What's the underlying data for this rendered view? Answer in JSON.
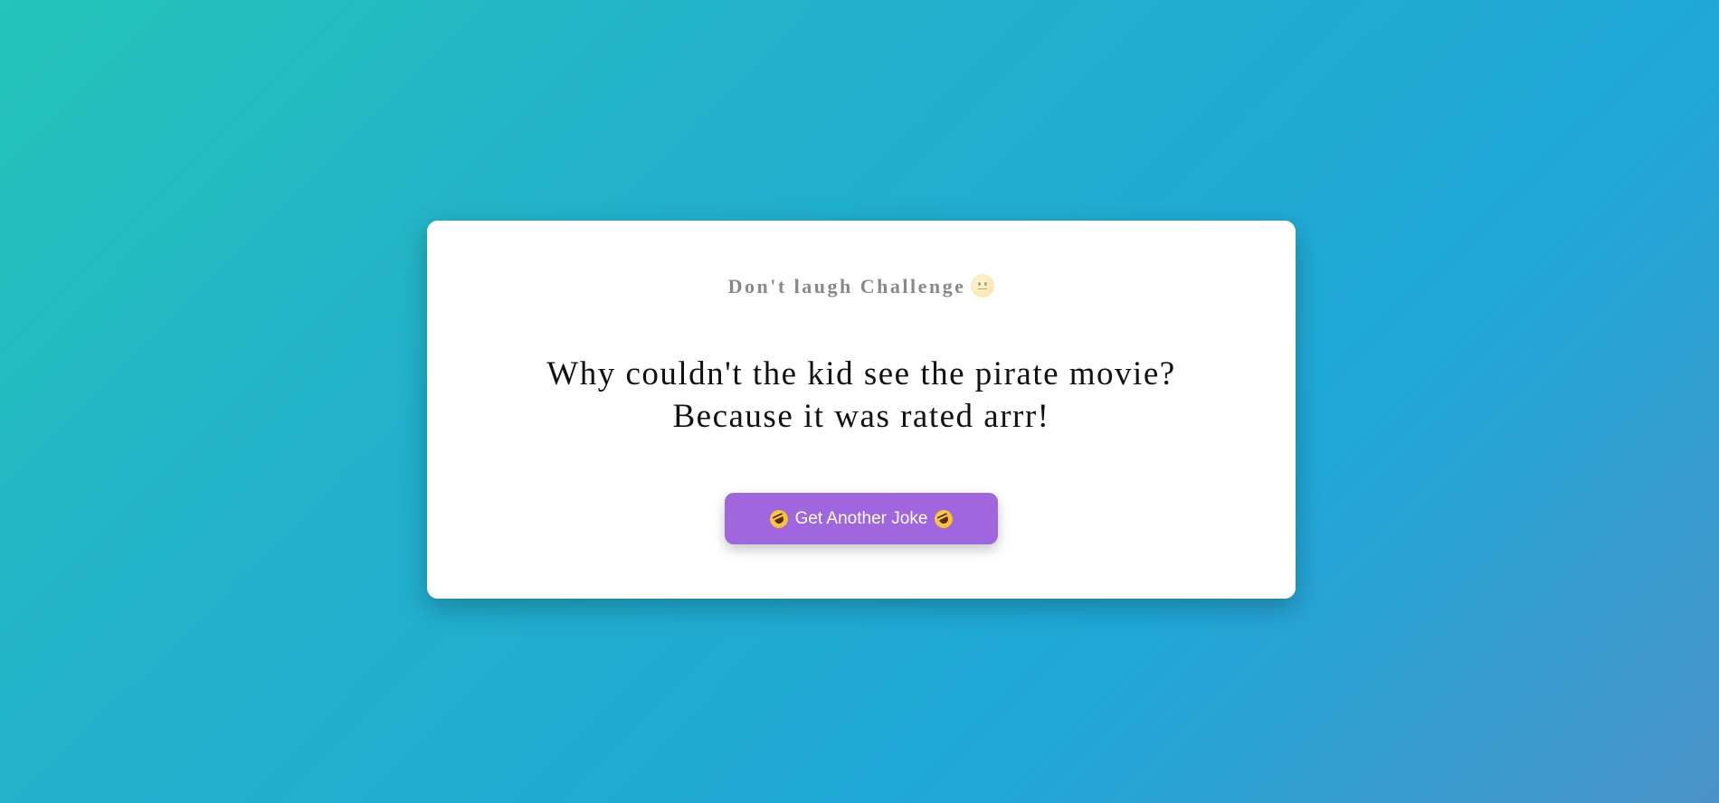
{
  "card": {
    "title": "Don't laugh Challenge",
    "title_icon": "grimacing-face-icon",
    "joke_setup": "Why couldn't the kid see the pirate movie?",
    "joke_punchline": "Because it was rated arrr!",
    "button": {
      "label": "Get Another Joke",
      "icon": "rolling-on-floor-laughing-icon"
    }
  },
  "colors": {
    "background_start": "#25c3b9",
    "background_end": "#1fa8d8",
    "button": "#9f66de",
    "title_text": "#888888",
    "joke_text": "#111111"
  }
}
